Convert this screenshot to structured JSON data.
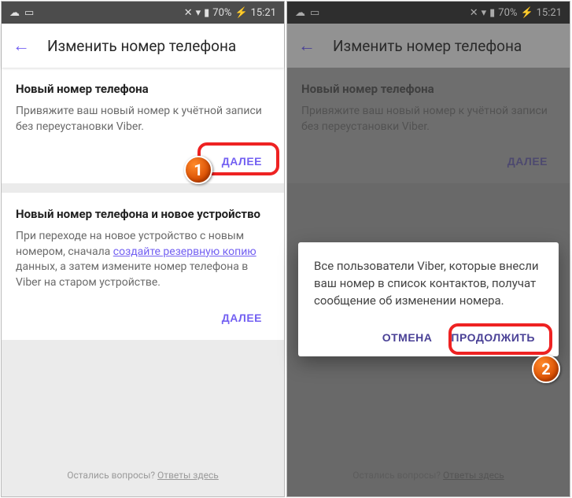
{
  "statusbar": {
    "battery": "70%",
    "time": "15:21"
  },
  "appbar": {
    "title": "Изменить номер телефона"
  },
  "card1": {
    "title": "Новый номер телефона",
    "desc": "Привяжите ваш новый номер к учётной записи без переустановки Viber.",
    "btn": "ДАЛЕЕ"
  },
  "card2": {
    "title": "Новый номер телефона и новое устройство",
    "desc_a": "При переходе на новое устройство с новым номером, сначала ",
    "link": "создайте резервную копию",
    "desc_b": " данных, а затем измените номер телефона в Viber на старом устройстве.",
    "btn": "ДАЛЕЕ"
  },
  "footer": {
    "q": "Остались вопросы? ",
    "a": "Ответы здесь"
  },
  "dialog": {
    "text": "Все пользователи Viber, которые внесли ваш номер в список контактов, получат сообщение об изменении номера.",
    "cancel": "ОТМЕНА",
    "ok": "ПРОДОЛЖИТЬ"
  },
  "badges": {
    "one": "1",
    "two": "2"
  }
}
